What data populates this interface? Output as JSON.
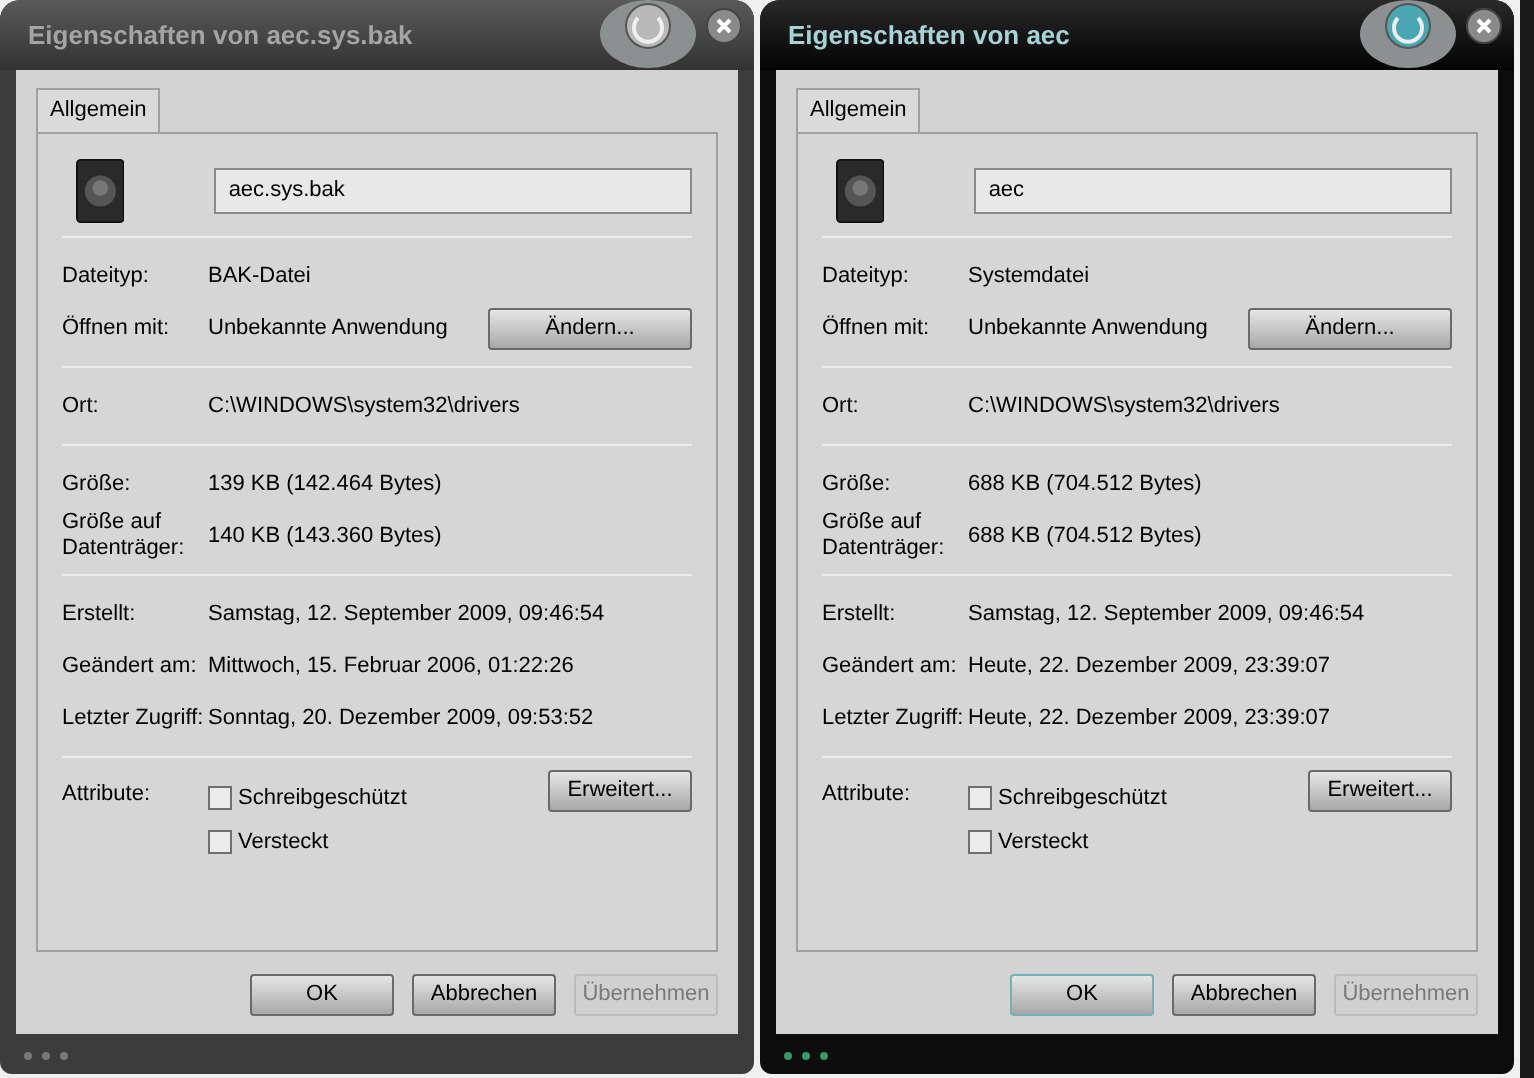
{
  "windows": [
    {
      "title": "Eigenschaften von aec.sys.bak",
      "active": false,
      "tabs": [
        {
          "label": "Allgemein",
          "selected": true
        }
      ],
      "filename": "aec.sys.bak",
      "groups": [
        [
          {
            "kind": "text",
            "label": "Dateityp:",
            "value": "BAK-Datei"
          },
          {
            "kind": "button",
            "label": "Öffnen mit:",
            "value": "Unbekannte Anwendung",
            "button": {
              "label": "Ändern...",
              "disabled": false
            }
          }
        ],
        [
          {
            "kind": "text",
            "label": "Ort:",
            "value": "C:\\WINDOWS\\system32\\drivers"
          }
        ],
        [
          {
            "kind": "text",
            "label": "Größe:",
            "value": "139 KB (142.464 Bytes)"
          },
          {
            "kind": "text",
            "label": "Größe auf Datenträger:",
            "value": "140 KB (143.360 Bytes)"
          }
        ],
        [
          {
            "kind": "text",
            "label": "Erstellt:",
            "value": "Samstag, 12. September 2009, 09:46:54"
          },
          {
            "kind": "text",
            "label": "Geändert am:",
            "value": "Mittwoch, 15. Februar 2006, 01:22:26"
          },
          {
            "kind": "text",
            "label": "Letzter Zugriff:",
            "value": "Sonntag, 20. Dezember 2009, 09:53:52"
          }
        ],
        [
          {
            "kind": "attributes",
            "label": "Attribute:",
            "checkboxes": [
              {
                "label": "Schreibgeschützt",
                "checked": false
              },
              {
                "label": "Versteckt",
                "checked": false
              }
            ],
            "button": {
              "label": "Erweitert...",
              "disabled": false
            }
          }
        ]
      ],
      "buttons": [
        {
          "label": "OK",
          "disabled": false
        },
        {
          "label": "Abbrechen",
          "disabled": false
        },
        {
          "label": "Übernehmen",
          "disabled": true
        }
      ]
    },
    {
      "title": "Eigenschaften von aec",
      "active": true,
      "tabs": [
        {
          "label": "Allgemein",
          "selected": true
        }
      ],
      "filename": "aec",
      "groups": [
        [
          {
            "kind": "text",
            "label": "Dateityp:",
            "value": "Systemdatei"
          },
          {
            "kind": "button",
            "label": "Öffnen mit:",
            "value": "Unbekannte Anwendung",
            "button": {
              "label": "Ändern...",
              "disabled": false
            }
          }
        ],
        [
          {
            "kind": "text",
            "label": "Ort:",
            "value": "C:\\WINDOWS\\system32\\drivers"
          }
        ],
        [
          {
            "kind": "text",
            "label": "Größe:",
            "value": "688 KB (704.512 Bytes)"
          },
          {
            "kind": "text",
            "label": "Größe auf Datenträger:",
            "value": "688 KB (704.512 Bytes)"
          }
        ],
        [
          {
            "kind": "text",
            "label": "Erstellt:",
            "value": "Samstag, 12. September 2009, 09:46:54"
          },
          {
            "kind": "text",
            "label": "Geändert am:",
            "value": "Heute, 22. Dezember 2009, 23:39:07"
          },
          {
            "kind": "text",
            "label": "Letzter Zugriff:",
            "value": "Heute, 22. Dezember 2009, 23:39:07"
          }
        ],
        [
          {
            "kind": "attributes",
            "label": "Attribute:",
            "checkboxes": [
              {
                "label": "Schreibgeschützt",
                "checked": false
              },
              {
                "label": "Versteckt",
                "checked": false
              }
            ],
            "button": {
              "label": "Erweitert...",
              "disabled": false
            }
          }
        ]
      ],
      "buttons": [
        {
          "label": "OK",
          "disabled": false
        },
        {
          "label": "Abbrechen",
          "disabled": false
        },
        {
          "label": "Übernehmen",
          "disabled": true
        }
      ]
    }
  ]
}
